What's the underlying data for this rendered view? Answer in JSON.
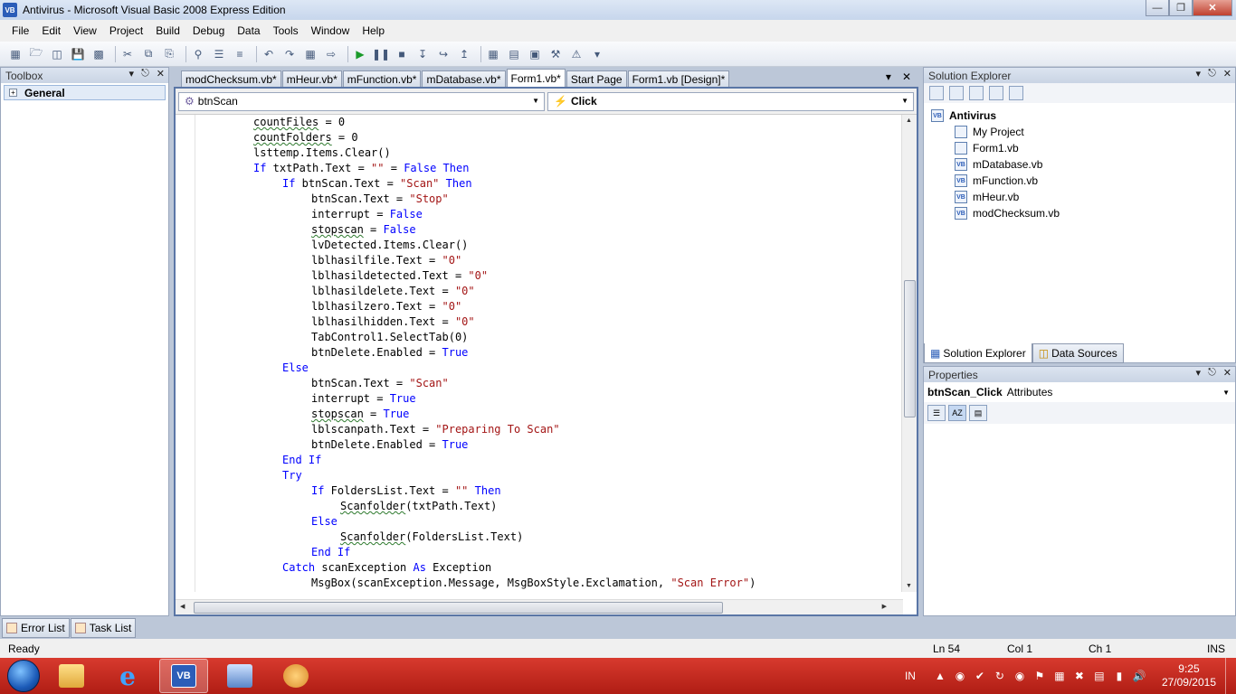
{
  "window": {
    "title": "Antivirus - Microsoft Visual Basic 2008 Express Edition"
  },
  "menu": [
    "File",
    "Edit",
    "View",
    "Project",
    "Build",
    "Debug",
    "Data",
    "Tools",
    "Window",
    "Help"
  ],
  "toolbox": {
    "title": "Toolbox",
    "group": "General"
  },
  "doc_tabs": [
    "modChecksum.vb*",
    "mHeur.vb*",
    "mFunction.vb*",
    "mDatabase.vb*",
    "Form1.vb*",
    "Start Page",
    "Form1.vb [Design]*"
  ],
  "active_tab": "Form1.vb*",
  "editor": {
    "object_combo": "btnScan",
    "event_combo": "Click",
    "lines": [
      {
        "indent": 2,
        "parts": [
          {
            "t": "countFiles",
            "c": "sq"
          },
          {
            "t": " = 0"
          }
        ]
      },
      {
        "indent": 2,
        "parts": [
          {
            "t": "countFolders",
            "c": "sq"
          },
          {
            "t": " = 0"
          }
        ]
      },
      {
        "indent": 2,
        "parts": [
          {
            "t": "lsttemp.Items.Clear()"
          }
        ]
      },
      {
        "indent": 2,
        "parts": [
          {
            "t": "If",
            "c": "kw"
          },
          {
            "t": " txtPath.Text = "
          },
          {
            "t": "\"\"",
            "c": "str"
          },
          {
            "t": " = "
          },
          {
            "t": "False",
            "c": "kw"
          },
          {
            "t": " "
          },
          {
            "t": "Then",
            "c": "kw"
          }
        ]
      },
      {
        "indent": 3,
        "parts": [
          {
            "t": "If",
            "c": "kw"
          },
          {
            "t": " btnScan.Text = "
          },
          {
            "t": "\"Scan\"",
            "c": "str"
          },
          {
            "t": " "
          },
          {
            "t": "Then",
            "c": "kw"
          }
        ]
      },
      {
        "indent": 4,
        "parts": [
          {
            "t": "btnScan.Text = "
          },
          {
            "t": "\"Stop\"",
            "c": "str"
          }
        ]
      },
      {
        "indent": 4,
        "parts": [
          {
            "t": "interrupt = "
          },
          {
            "t": "False",
            "c": "kw"
          }
        ]
      },
      {
        "indent": 4,
        "parts": [
          {
            "t": "stopscan",
            "c": "sq"
          },
          {
            "t": " = "
          },
          {
            "t": "False",
            "c": "kw"
          }
        ]
      },
      {
        "indent": 4,
        "parts": [
          {
            "t": "lvDetected.Items.Clear()"
          }
        ]
      },
      {
        "indent": 4,
        "parts": [
          {
            "t": "lblhasilfile.Text = "
          },
          {
            "t": "\"0\"",
            "c": "str"
          }
        ]
      },
      {
        "indent": 4,
        "parts": [
          {
            "t": "lblhasildetected.Text = "
          },
          {
            "t": "\"0\"",
            "c": "str"
          }
        ]
      },
      {
        "indent": 4,
        "parts": [
          {
            "t": "lblhasildelete.Text = "
          },
          {
            "t": "\"0\"",
            "c": "str"
          }
        ]
      },
      {
        "indent": 4,
        "parts": [
          {
            "t": "lblhasilzero.Text = "
          },
          {
            "t": "\"0\"",
            "c": "str"
          }
        ]
      },
      {
        "indent": 4,
        "parts": [
          {
            "t": "lblhasilhidden.Text = "
          },
          {
            "t": "\"0\"",
            "c": "str"
          }
        ]
      },
      {
        "indent": 4,
        "parts": [
          {
            "t": "TabControl1.SelectTab(0)"
          }
        ]
      },
      {
        "indent": 4,
        "parts": [
          {
            "t": "btnDelete.Enabled = "
          },
          {
            "t": "True",
            "c": "kw"
          }
        ]
      },
      {
        "indent": 3,
        "parts": [
          {
            "t": "Else",
            "c": "kw"
          }
        ]
      },
      {
        "indent": 4,
        "parts": [
          {
            "t": "btnScan.Text = "
          },
          {
            "t": "\"Scan\"",
            "c": "str"
          }
        ]
      },
      {
        "indent": 4,
        "parts": [
          {
            "t": "interrupt = "
          },
          {
            "t": "True",
            "c": "kw"
          }
        ]
      },
      {
        "indent": 4,
        "parts": [
          {
            "t": "stopscan",
            "c": "sq"
          },
          {
            "t": " = "
          },
          {
            "t": "True",
            "c": "kw"
          }
        ]
      },
      {
        "indent": 4,
        "parts": [
          {
            "t": "lblscanpath.Text = "
          },
          {
            "t": "\"Preparing To Scan\"",
            "c": "str"
          }
        ]
      },
      {
        "indent": 4,
        "parts": [
          {
            "t": "btnDelete.Enabled = "
          },
          {
            "t": "True",
            "c": "kw"
          }
        ]
      },
      {
        "indent": 3,
        "parts": [
          {
            "t": "End If",
            "c": "kw"
          }
        ]
      },
      {
        "indent": 3,
        "parts": [
          {
            "t": "Try",
            "c": "kw"
          }
        ]
      },
      {
        "indent": 4,
        "parts": [
          {
            "t": "If",
            "c": "kw"
          },
          {
            "t": " FoldersList.Text = "
          },
          {
            "t": "\"\"",
            "c": "str"
          },
          {
            "t": " "
          },
          {
            "t": "Then",
            "c": "kw"
          }
        ]
      },
      {
        "indent": 5,
        "parts": [
          {
            "t": "Scanfolder",
            "c": "sq"
          },
          {
            "t": "(txtPath.Text)"
          }
        ]
      },
      {
        "indent": 4,
        "parts": [
          {
            "t": "Else",
            "c": "kw"
          }
        ]
      },
      {
        "indent": 5,
        "parts": [
          {
            "t": "Scanfolder",
            "c": "sq"
          },
          {
            "t": "(FoldersList.Text)"
          }
        ]
      },
      {
        "indent": 4,
        "parts": [
          {
            "t": "End If",
            "c": "kw"
          }
        ]
      },
      {
        "indent": 3,
        "parts": [
          {
            "t": "Catch",
            "c": "kw"
          },
          {
            "t": " scanException "
          },
          {
            "t": "As",
            "c": "kw"
          },
          {
            "t": " Exception"
          }
        ]
      },
      {
        "indent": 4,
        "parts": [
          {
            "t": "MsgBox(scanException.Message, MsgBoxStyle.Exclamation, "
          },
          {
            "t": "\"Scan Error\"",
            "c": "str"
          },
          {
            "t": ")"
          }
        ]
      }
    ]
  },
  "solution_explorer": {
    "title": "Solution Explorer",
    "project": "Antivirus",
    "items": [
      "My Project",
      "Form1.vb",
      "mDatabase.vb",
      "mFunction.vb",
      "mHeur.vb",
      "modChecksum.vb"
    ],
    "tabs": [
      "Solution Explorer",
      "Data Sources"
    ]
  },
  "properties": {
    "title": "Properties",
    "object_name": "btnScan_Click",
    "object_type": "Attributes"
  },
  "bottom_tabs": [
    "Error List",
    "Task List"
  ],
  "status": {
    "text": "Ready",
    "ln": "Ln 54",
    "col": "Col 1",
    "ch": "Ch 1",
    "mode": "INS"
  },
  "taskbar": {
    "lang": "IN",
    "time": "9:25",
    "date": "27/09/2015"
  },
  "colors": {
    "taskbar": "#c5291f",
    "keyword": "#0000ff",
    "string": "#a31515"
  }
}
